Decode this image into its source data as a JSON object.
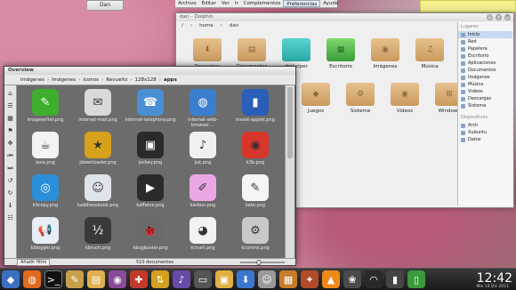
{
  "top_button": "Dan",
  "menubar": {
    "items": [
      "Archivo",
      "Editar",
      "Ver",
      "Ir",
      "Complementos",
      "Preferencias",
      "Ayuda"
    ],
    "active_index": 5
  },
  "dolphin": {
    "title": "dan – Dolphin",
    "breadcrumb": [
      "/",
      "home",
      "dan"
    ],
    "items": [
      {
        "label": "Descargas",
        "style": "tan",
        "glyph": "⬇"
      },
      {
        "label": "Documentos",
        "style": "tan",
        "glyph": "▤"
      },
      {
        "label": "dwhelper",
        "style": "teal",
        "glyph": ""
      },
      {
        "label": "Escritorio",
        "style": "green",
        "glyph": "▦"
      },
      {
        "label": "Imágenes",
        "style": "tan",
        "glyph": "◉"
      },
      {
        "label": "Música",
        "style": "tan",
        "glyph": "♫"
      },
      {
        "label": "",
        "style": "red",
        "glyph": ""
      },
      {
        "label": "Juegos",
        "style": "tan",
        "glyph": "◆"
      },
      {
        "label": "Sistema",
        "style": "tan",
        "glyph": "⚙"
      },
      {
        "label": "Videos",
        "style": "tan",
        "glyph": "◉"
      },
      {
        "label": "Windows",
        "style": "tan",
        "glyph": "⊞"
      }
    ],
    "places_header": "Lugares",
    "places": [
      "Inicio",
      "Red",
      "Papelera",
      "Escritorio",
      "Aplicaciones",
      "Documentos",
      "Imágenes",
      "Música",
      "Videos",
      "Descargas",
      "Sistema"
    ],
    "places_selected": 0,
    "devices_header": "Dispositivos",
    "devices": [
      "Arch",
      "Xubuntu",
      "Datos"
    ]
  },
  "overview": {
    "title": "Overview",
    "path": [
      "Imágenes",
      "Imágenes",
      "iconos",
      "Revuelto",
      "128x128",
      "apps"
    ],
    "files": [
      {
        "name": "imagewriter.png",
        "color": "#3fae2f",
        "glyph": "✎"
      },
      {
        "name": "internet-mail.png",
        "color": "#d9d9d9",
        "glyph": "✉"
      },
      {
        "name": "internet-telephony.png",
        "color": "#4a8fd6",
        "glyph": "☎"
      },
      {
        "name": "internet-web-browser....",
        "color": "#3a7fcf",
        "glyph": "◍"
      },
      {
        "name": "invest-applet.png",
        "color": "#2a5eb8",
        "glyph": "▮"
      },
      {
        "name": "java.png",
        "color": "#f3f3f3",
        "glyph": "☕"
      },
      {
        "name": "jdownloader.png",
        "color": "#d6a21c",
        "glyph": "★"
      },
      {
        "name": "jockey.png",
        "color": "#2a2a2a",
        "glyph": "▣"
      },
      {
        "name": "juk.png",
        "color": "#f0f0f0",
        "glyph": "♪"
      },
      {
        "name": "k3b.png",
        "color": "#d8362a",
        "glyph": "◉"
      },
      {
        "name": "k9copy.png",
        "color": "#2a8fd8",
        "glyph": "◎"
      },
      {
        "name": "kaddressbook.png",
        "color": "#dfe3ea",
        "glyph": "☺"
      },
      {
        "name": "kaffeine.png",
        "color": "#2a2a2a",
        "glyph": "▶"
      },
      {
        "name": "karbon.png",
        "color": "#e9a8e5",
        "glyph": "✐"
      },
      {
        "name": "kate.png",
        "color": "#f5f5f5",
        "glyph": "✎"
      },
      {
        "name": "kblogger.png",
        "color": "#e8eef6",
        "glyph": "📢"
      },
      {
        "name": "kbruch.png",
        "color": "#3a3a3a",
        "glyph": "½"
      },
      {
        "name": "kbugbuster.png",
        "color": "#6a6a6a",
        "glyph": "🐞"
      },
      {
        "name": "kchart.png",
        "color": "#f2f2f2",
        "glyph": "◕"
      },
      {
        "name": "kcontrol.png",
        "color": "#c9c9c9",
        "glyph": "⚙"
      }
    ],
    "add_filter": "Añadir filtro",
    "count": "510 documentos"
  },
  "taskbar": {
    "time": "12:42",
    "date": "Mie 14 Dic 2011"
  }
}
